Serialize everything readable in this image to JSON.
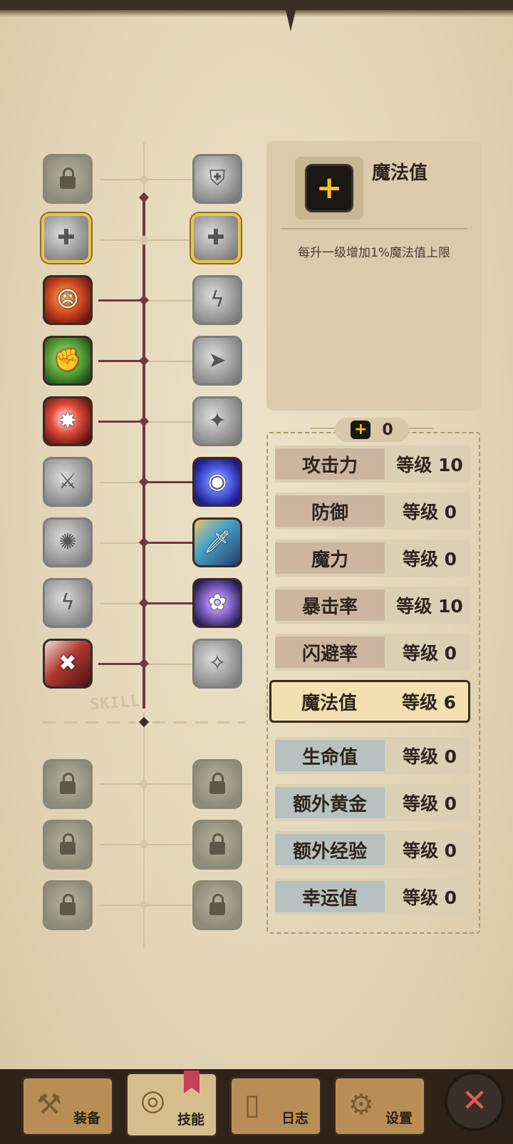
{
  "detail": {
    "icon": "plus-icon",
    "plus_glyph": "+",
    "title": "魔法值",
    "description": "每升一级增加1%魔法值上限"
  },
  "points": {
    "icon": "plus-icon",
    "plus_glyph": "+",
    "value": "0"
  },
  "stats": [
    {
      "name": "攻击力",
      "level": "等级 10"
    },
    {
      "name": "防御",
      "level": "等级 0"
    },
    {
      "name": "魔力",
      "level": "等级 0"
    },
    {
      "name": "暴击率",
      "level": "等级 10"
    },
    {
      "name": "闪避率",
      "level": "等级 0"
    },
    {
      "name": "魔法值",
      "level": "等级 6"
    },
    {
      "name": "生命值",
      "level": "等级 0"
    },
    {
      "name": "额外黄金",
      "level": "等级 0"
    },
    {
      "name": "额外经验",
      "level": "等级 0"
    },
    {
      "name": "幸运值",
      "level": "等级 0"
    }
  ],
  "tree": {
    "label": "SKILL"
  },
  "nav": {
    "equip": "装备",
    "skills": "技能",
    "log": "日志",
    "settings": "设置",
    "close_glyph": "✕"
  },
  "colors": {
    "accent_gold": "#f3c41a",
    "selected_border": "#3a2c1c",
    "close_red": "#e05a5a"
  }
}
